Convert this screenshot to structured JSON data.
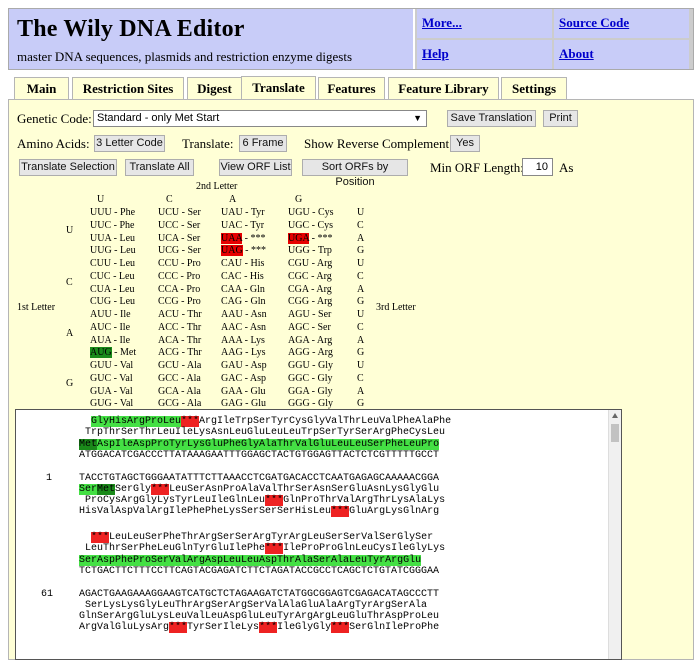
{
  "app": {
    "title": "The Wily DNA Editor",
    "subtitle": "master DNA sequences, plasmids and restriction enzyme digests"
  },
  "header_links": {
    "more": "More...",
    "source": "Source Code",
    "help": "Help",
    "about": "About"
  },
  "tabs": [
    "Main",
    "Restriction Sites",
    "Digest",
    "Translate",
    "Features",
    "Feature Library",
    "Settings"
  ],
  "active_tab": "Translate",
  "controls": {
    "genetic_code_label": "Genetic Code:",
    "genetic_code_value": "Standard - only Met Start",
    "save_translation": "Save Translation",
    "print": "Print",
    "amino_acids_label": "Amino Acids:",
    "amino_acids_value": "3 Letter Code",
    "translate_label": "Translate:",
    "translate_value": "6 Frame",
    "show_rc_label": "Show Reverse Complement:",
    "show_rc_value": "Yes",
    "translate_selection": "Translate Selection",
    "translate_all": "Translate All",
    "view_orf_list": "View ORF List",
    "sort_orfs": "Sort ORFs by Position",
    "min_orf_label": "Min ORF Length:",
    "min_orf_value": "10",
    "min_orf_unit": "As"
  },
  "codon_table": {
    "second_letter": "2nd Letter",
    "first_letter": "1st Letter",
    "third_letter": "3rd Letter",
    "col_headers": [
      "U",
      "C",
      "A",
      "G"
    ],
    "row_headers": [
      "U",
      "C",
      "A",
      "G"
    ],
    "third": [
      "U",
      "C",
      "A",
      "G",
      "U",
      "C",
      "A",
      "G",
      "U",
      "C",
      "A",
      "G",
      "U",
      "C",
      "A",
      "G"
    ],
    "rows": [
      [
        [
          "UUU",
          "Phe"
        ],
        [
          "UCU",
          "Ser"
        ],
        [
          "UAU",
          "Tyr"
        ],
        [
          "UGU",
          "Cys"
        ]
      ],
      [
        [
          "UUC",
          "Phe"
        ],
        [
          "UCC",
          "Ser"
        ],
        [
          "UAC",
          "Tyr"
        ],
        [
          "UGC",
          "Cys"
        ]
      ],
      [
        [
          "UUA",
          "Leu"
        ],
        [
          "UCA",
          "Ser"
        ],
        [
          "UAA",
          "***",
          "stop"
        ],
        [
          "UGA",
          "***",
          "stop"
        ]
      ],
      [
        [
          "UUG",
          "Leu"
        ],
        [
          "UCG",
          "Ser"
        ],
        [
          "UAG",
          "***",
          "stop"
        ],
        [
          "UGG",
          "Trp"
        ]
      ],
      [
        [
          "CUU",
          "Leu"
        ],
        [
          "CCU",
          "Pro"
        ],
        [
          "CAU",
          "His"
        ],
        [
          "CGU",
          "Arg"
        ]
      ],
      [
        [
          "CUC",
          "Leu"
        ],
        [
          "CCC",
          "Pro"
        ],
        [
          "CAC",
          "His"
        ],
        [
          "CGC",
          "Arg"
        ]
      ],
      [
        [
          "CUA",
          "Leu"
        ],
        [
          "CCA",
          "Pro"
        ],
        [
          "CAA",
          "Gln"
        ],
        [
          "CGA",
          "Arg"
        ]
      ],
      [
        [
          "CUG",
          "Leu"
        ],
        [
          "CCG",
          "Pro"
        ],
        [
          "CAG",
          "Gln"
        ],
        [
          "CGG",
          "Arg"
        ]
      ],
      [
        [
          "AUU",
          "Ile"
        ],
        [
          "ACU",
          "Thr"
        ],
        [
          "AAU",
          "Asn"
        ],
        [
          "AGU",
          "Ser"
        ]
      ],
      [
        [
          "AUC",
          "Ile"
        ],
        [
          "ACC",
          "Thr"
        ],
        [
          "AAC",
          "Asn"
        ],
        [
          "AGC",
          "Ser"
        ]
      ],
      [
        [
          "AUA",
          "Ile"
        ],
        [
          "ACA",
          "Thr"
        ],
        [
          "AAA",
          "Lys"
        ],
        [
          "AGA",
          "Arg"
        ]
      ],
      [
        [
          "AUG",
          "Met",
          "start"
        ],
        [
          "ACG",
          "Thr"
        ],
        [
          "AAG",
          "Lys"
        ],
        [
          "AGG",
          "Arg"
        ]
      ],
      [
        [
          "GUU",
          "Val"
        ],
        [
          "GCU",
          "Ala"
        ],
        [
          "GAU",
          "Asp"
        ],
        [
          "GGU",
          "Gly"
        ]
      ],
      [
        [
          "GUC",
          "Val"
        ],
        [
          "GCC",
          "Ala"
        ],
        [
          "GAC",
          "Asp"
        ],
        [
          "GGC",
          "Gly"
        ]
      ],
      [
        [
          "GUA",
          "Val"
        ],
        [
          "GCA",
          "Ala"
        ],
        [
          "GAA",
          "Glu"
        ],
        [
          "GGA",
          "Gly"
        ]
      ],
      [
        [
          "GUG",
          "Val"
        ],
        [
          "GCG",
          "Ala"
        ],
        [
          "GAG",
          "Glu"
        ],
        [
          "GGG",
          "Gly"
        ]
      ]
    ]
  },
  "sequence": {
    "blocks": [
      {
        "position": "1",
        "lines": [
          [
            [
              "     ",
              ""
            ],
            [
              "GlyHisArgProLeu",
              "g"
            ],
            [
              "***",
              "r"
            ],
            [
              "ArgIleTrpSerTyrCysGlyValThrLeuValPheAlaPhe",
              ""
            ]
          ],
          [
            [
              "    TrpThrSerThrLeuIleLysAsnLeuGluLeuLeuTrpSerTyrSerArgPheCysLeu",
              ""
            ]
          ],
          [
            [
              "   ",
              ""
            ],
            [
              "Met",
              "dg"
            ],
            [
              "AspIleAspProTyrLysGluPheGlyAlaThrValGluLeuLeuSerPheLeuPro",
              "g"
            ]
          ],
          [
            [
              "   ATGGACATCGACCCTTATAAAGAATTTGGAGCTACTGTGGAGTTACTCTCGTTTTTGCCT",
              ""
            ]
          ],
          [
            [
              "",
              ""
            ]
          ],
          [
            [
              "   TACCTGTAGCTGGGAATATTTCTTAAACCTCGATGACACCTCAATGAGAGCAAAAACGGA",
              ""
            ]
          ],
          [
            [
              "   ",
              ""
            ],
            [
              "Ser",
              "g"
            ],
            [
              "Met",
              "dg"
            ],
            [
              "SerGly",
              ""
            ],
            [
              "***",
              "r"
            ],
            [
              "LeuSerAsnProAlaValThrSerAsnSerGluAsnLysGlyGlu",
              ""
            ]
          ],
          [
            [
              "    ProCysArgGlyLysTyrLeuIleGlnLeu",
              ""
            ],
            [
              "***",
              "r"
            ],
            [
              "GlnProThrValArgThrLysAlaLys",
              ""
            ]
          ],
          [
            [
              "   HisValAspValArgIlePhePheLysSerSerSerHisLeu",
              ""
            ],
            [
              "***",
              "r"
            ],
            [
              "GluArgLysGlnArg",
              ""
            ]
          ]
        ]
      },
      {
        "position": "61",
        "lines": [
          [
            [
              "     ",
              ""
            ],
            [
              "***",
              "r"
            ],
            [
              "LeuLeuSerPheThrArgSerSerArgTyrArgLeuSerSerValSerGlySer",
              ""
            ]
          ],
          [
            [
              "    LeuThrSerPheLeuGlnTyrGluIlePhe",
              ""
            ],
            [
              "***",
              "r"
            ],
            [
              "IleProProGlnLeuCysIleGlyLys",
              ""
            ]
          ],
          [
            [
              "   ",
              ""
            ],
            [
              "SerAspPheProSerValArgAspLeuLeuAspThrAlaSerAlaLeuTyrArgGlu",
              "g"
            ]
          ],
          [
            [
              "   TCTGACTTCTTTCCTTCAGTACGAGATCTTCTAGATACCGCCTCAGCTCTGTATCGGGAA",
              ""
            ]
          ],
          [
            [
              "",
              ""
            ]
          ],
          [
            [
              "   AGACTGAAGAAAGGAAGTCATGCTCTAGAAGATCTATGGCGGAGTCGAGACATAGCCCTT",
              ""
            ]
          ],
          [
            [
              "    SerLysLysGlyLeuThrArgSerArgSerValAlaGluAlaArgTyrArgSerAla",
              ""
            ]
          ],
          [
            [
              "   GlnSerArgGluLysLeuValLeuAspGluLeuTyrArgArgLeuGluThrAspProLeu",
              ""
            ]
          ],
          [
            [
              "   ArgValGluLysArg",
              ""
            ],
            [
              "***",
              "r"
            ],
            [
              "TyrSerIleLys",
              ""
            ],
            [
              "***",
              "r"
            ],
            [
              "IleGlyGly",
              ""
            ],
            [
              "***",
              "r"
            ],
            [
              "SerGlnIleProPhe",
              ""
            ]
          ]
        ]
      }
    ]
  },
  "colors": {
    "header_bg": "#c8ccf8",
    "panel_bg": "#ffffd6",
    "stop": "#e60000",
    "start": "#1a8a1a",
    "orf_highlight": "#44e044"
  }
}
